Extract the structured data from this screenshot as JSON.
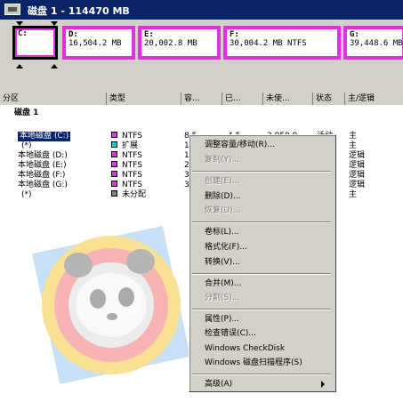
{
  "disk": {
    "title": "磁盘 1 - 114470 MB"
  },
  "partitions_map": [
    {
      "label": "C:",
      "info": ""
    },
    {
      "label": "D:",
      "info": "16,504.2 MB"
    },
    {
      "label": "E:",
      "info": "20,002.8 MB"
    },
    {
      "label": "F:",
      "info": "30,004.2 MB   NTFS"
    },
    {
      "label": "G:",
      "info": "39,448.6 MB"
    }
  ],
  "columns": [
    "分区",
    "类型",
    "容...",
    "已...",
    "未使...",
    "状态",
    "主/逻辑"
  ],
  "group_label": "磁盘 1",
  "rows": [
    {
      "name": "本地磁盘 (C:)",
      "type": "NTFS",
      "color": "#e030e0",
      "size": "8,5",
      "used": "4,5",
      "free": "3,959.9",
      "status": "活动",
      "kind": "主"
    },
    {
      "name": "(*)",
      "type": "扩展",
      "color": "#20c8c8",
      "size": "1",
      "used": "",
      "free": "",
      "status": "",
      "kind": "主"
    },
    {
      "name": "本地磁盘 (D:)",
      "type": "NTFS",
      "color": "#e030e0",
      "size": "1",
      "used": "",
      "free": "",
      "status": "",
      "kind": "逻辑"
    },
    {
      "name": "本地磁盘 (E:)",
      "type": "NTFS",
      "color": "#e030e0",
      "size": "2",
      "used": "",
      "free": "",
      "status": "",
      "kind": "逻辑"
    },
    {
      "name": "本地磁盘 (F:)",
      "type": "NTFS",
      "color": "#e030e0",
      "size": "3",
      "used": "",
      "free": "",
      "status": "",
      "kind": "逻辑"
    },
    {
      "name": "本地磁盘 (G:)",
      "type": "NTFS",
      "color": "#e030e0",
      "size": "3",
      "used": "",
      "free": "",
      "status": "",
      "kind": "逻辑"
    },
    {
      "name": "(*)",
      "type": "未分配",
      "color": "#808080",
      "size": "",
      "used": "",
      "free": "",
      "status": "",
      "kind": "主"
    }
  ],
  "menu": {
    "resize": "调整容量/移动(R)...",
    "copy": "复制(Y)...",
    "create": "创建(E)...",
    "delete": "删除(D)...",
    "restore": "恢复(U)...",
    "label": "卷标(L)...",
    "format": "格式化(F)...",
    "convert": "转换(V)...",
    "merge": "合并(M)...",
    "split": "分割(S)...",
    "properties": "属性(P)...",
    "check": "检查错误(C)...",
    "checkdisk": "Windows CheckDisk",
    "scandisk": "Windows 磁盘扫描程序(S)",
    "advanced": "高级(A)"
  }
}
